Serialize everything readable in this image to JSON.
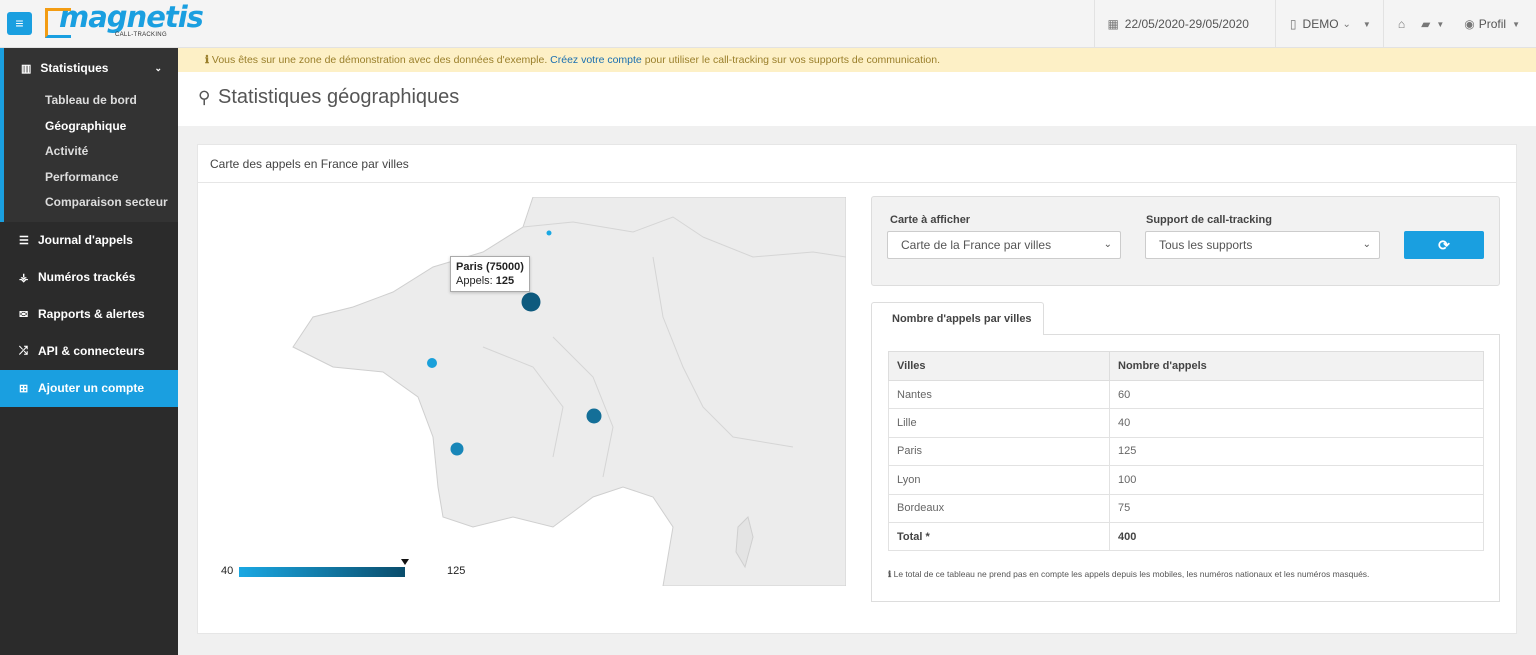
{
  "app": {
    "menu_icon": "hamburger-icon",
    "logo_text": "magnetis",
    "logo_sub": "CALL-TRACKING"
  },
  "topbar": {
    "date_range": "22/05/2020-29/05/2020",
    "account": "DEMO",
    "profile": "Profil"
  },
  "sidebar": {
    "statistiques": "Statistiques",
    "sub_items": [
      "Tableau de bord",
      "Géographique",
      "Activité",
      "Performance",
      "Comparaison secteur"
    ],
    "items": [
      "Journal d'appels",
      "Numéros trackés",
      "Rapports & alertes",
      "API & connecteurs",
      "Ajouter un compte"
    ]
  },
  "notice": {
    "prefix": "Vous êtes sur une zone de démonstration avec des données d'exemple.",
    "link": "Créez votre compte",
    "suffix": "pour utiliser le call-tracking sur vos supports de communication."
  },
  "page": {
    "title": "Statistiques géographiques",
    "panel_title": "Carte des appels en France par villes"
  },
  "map": {
    "legend_min": "40",
    "legend_max": "125",
    "legend_marker_value": 125,
    "colors": {
      "low": "#1aa8e3",
      "high": "#0a4d6c"
    },
    "tooltip": {
      "title": "Paris (75000)",
      "label": "Appels:",
      "value": "125"
    }
  },
  "filters": {
    "map_label": "Carte à afficher",
    "map_value": "Carte de la France par villes",
    "support_label": "Support de call-tracking",
    "support_value": "Tous les supports",
    "refresh_icon": "refresh-icon"
  },
  "table": {
    "tab_label": "Nombre d'appels par villes",
    "headers": [
      "Villes",
      "Nombre d'appels"
    ],
    "rows": [
      [
        "Nantes",
        "60"
      ],
      [
        "Lille",
        "40"
      ],
      [
        "Paris",
        "125"
      ],
      [
        "Lyon",
        "100"
      ],
      [
        "Bordeaux",
        "75"
      ]
    ],
    "total": [
      "Total *",
      "400"
    ],
    "footnote": "Le total de ce tableau ne prend pas en compte les appels depuis les mobiles, les numéros nationaux et les numéros masqués."
  }
}
